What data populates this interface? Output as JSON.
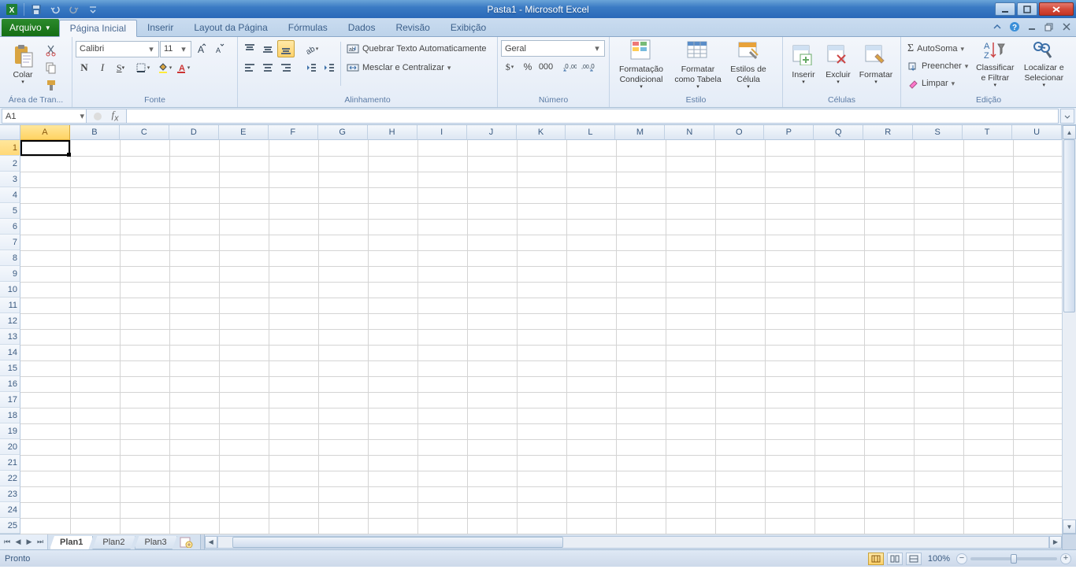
{
  "title": "Pasta1 - Microsoft Excel",
  "tabs": {
    "file": "Arquivo",
    "home": "Página Inicial",
    "insert": "Inserir",
    "layout": "Layout da Página",
    "formulas": "Fórmulas",
    "data": "Dados",
    "review": "Revisão",
    "view": "Exibição"
  },
  "groups": {
    "clipboard": {
      "label": "Área de Tran...",
      "paste": "Colar"
    },
    "font": {
      "label": "Fonte",
      "name": "Calibri",
      "size": "11"
    },
    "alignment": {
      "label": "Alinhamento",
      "wrap": "Quebrar Texto Automaticamente",
      "merge": "Mesclar e Centralizar"
    },
    "number": {
      "label": "Número",
      "format": "Geral"
    },
    "styles": {
      "label": "Estilo",
      "cond": "Formatação Condicional",
      "table": "Formatar como Tabela",
      "cell": "Estilos de Célula"
    },
    "cells": {
      "label": "Células",
      "insert": "Inserir",
      "delete": "Excluir",
      "format": "Formatar"
    },
    "editing": {
      "label": "Edição",
      "sum": "AutoSoma",
      "fill": "Preencher",
      "clear": "Limpar",
      "sort": "Classificar e Filtrar",
      "find": "Localizar e Selecionar"
    }
  },
  "namebox": "A1",
  "columns": [
    "A",
    "B",
    "C",
    "D",
    "E",
    "F",
    "G",
    "H",
    "I",
    "J",
    "K",
    "L",
    "M",
    "N",
    "O",
    "P",
    "Q",
    "R",
    "S",
    "T",
    "U"
  ],
  "rows": [
    "1",
    "2",
    "3",
    "4",
    "5",
    "6",
    "7",
    "8",
    "9",
    "10",
    "11",
    "12",
    "13",
    "14",
    "15",
    "16",
    "17",
    "18",
    "19",
    "20",
    "21",
    "22",
    "23",
    "24",
    "25"
  ],
  "sheets": [
    "Plan1",
    "Plan2",
    "Plan3"
  ],
  "status": {
    "ready": "Pronto",
    "zoom": "100%"
  }
}
